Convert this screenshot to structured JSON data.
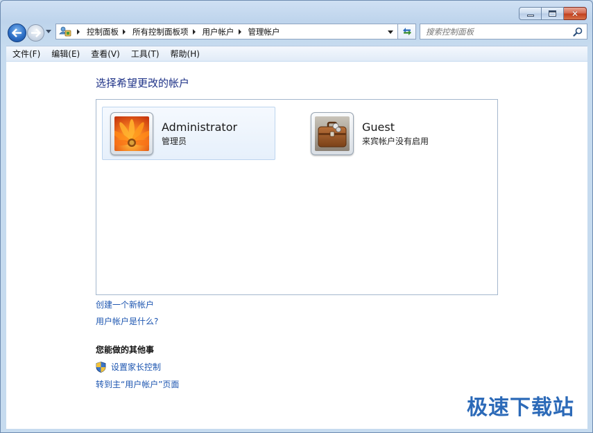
{
  "window": {
    "caption_buttons": [
      "minimize",
      "maximize",
      "close"
    ]
  },
  "nav": {
    "breadcrumbs": [
      "控制面板",
      "所有控制面板项",
      "用户帐户",
      "管理帐户"
    ],
    "search_placeholder": "搜索控制面板"
  },
  "menu": {
    "items": [
      "文件(F)",
      "编辑(E)",
      "查看(V)",
      "工具(T)",
      "帮助(H)"
    ]
  },
  "main": {
    "heading": "选择希望更改的帐户",
    "accounts": [
      {
        "name": "Administrator",
        "role": "管理员",
        "icon": "flower-avatar-icon",
        "selected": true
      },
      {
        "name": "Guest",
        "role": "来宾帐户没有启用",
        "icon": "briefcase-avatar-icon",
        "selected": false
      }
    ],
    "links": {
      "create": "创建一个新帐户",
      "what": "用户帐户是什么?"
    },
    "other_section": {
      "title": "您能做的其他事",
      "parental": "设置家长控制",
      "goto": "转到主“用户帐户”页面"
    }
  },
  "watermark": "极速下载站",
  "colors": {
    "link": "#1c55b0",
    "heading": "#1e3287",
    "chrome": "#c6dbef",
    "close_button": "#c2411f"
  }
}
